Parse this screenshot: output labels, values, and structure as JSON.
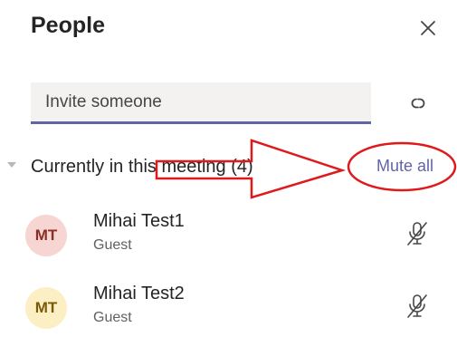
{
  "panel": {
    "title": "People"
  },
  "invite": {
    "placeholder": "Invite someone"
  },
  "section": {
    "label": "Currently in this meeting (4)",
    "mute_all": "Mute all"
  },
  "participants": [
    {
      "initials": "MT",
      "name": "Mihai Test1",
      "role": "Guest",
      "avatar_bg": "#f6d5d2",
      "avatar_fg": "#8a2f26"
    },
    {
      "initials": "MT",
      "name": "Mihai Test2",
      "role": "Guest",
      "avatar_bg": "#fcefc4",
      "avatar_fg": "#7a5a06"
    }
  ],
  "icons": {
    "close": "close-icon",
    "link": "copy-link-icon",
    "mic": "mic-muted-icon",
    "caret": "caret-down-icon"
  },
  "colors": {
    "accent": "#6264a7",
    "annotation": "#e0191b"
  }
}
